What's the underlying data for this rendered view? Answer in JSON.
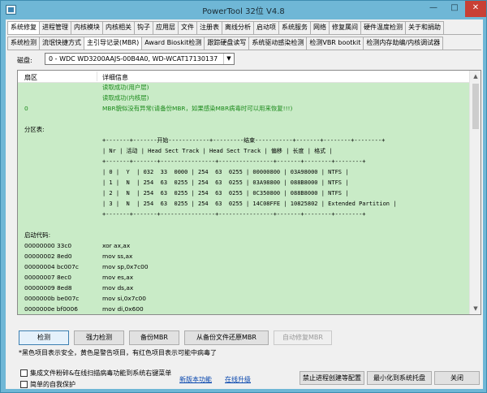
{
  "window": {
    "title": "PowerTool 32位 V4.8"
  },
  "tabs_main": [
    "系统修复",
    "进程管理",
    "内核模块",
    "内核相关",
    "钩子",
    "应用层",
    "文件",
    "注册表",
    "离线分析",
    "启动项",
    "系统服务",
    "网络",
    "修复属间",
    "硬件温度检测",
    "关于和捐助"
  ],
  "tabs_sub": [
    "系统检测",
    "流氓快捷方式",
    "主引导记录(MBR)",
    "Award Bioskit检测",
    "跟踪硬盘读写",
    "系统驱动感染检测",
    "检测VBR bootkit",
    "检测内存劫编/内核调试器"
  ],
  "disk": {
    "label": "磁盘:",
    "selected": "0 - WDC WD3200AAJS-00B4A0, WD-WCAT17130137"
  },
  "list": {
    "headers": [
      "扇区",
      "详细信息"
    ],
    "rows": [
      {
        "c1": "",
        "c2": "读取成功(用户层)",
        "green": true
      },
      {
        "c1": "",
        "c2": "读取成功(内核层)",
        "green": true
      },
      {
        "c1": "0",
        "c2": "MBR貌似没有异常(请备份MBR，如果感染MBR病毒时可以用来恢复!!!)",
        "green": true
      },
      {
        "c1": "",
        "c2": ""
      },
      {
        "c1": "分区表:",
        "c2": ""
      },
      {
        "c1": "",
        "c2": "+-------+-------开始------------+---------结束-----------+-------+--------+--------+",
        "mono": true
      },
      {
        "c1": "",
        "c2": "| Nr | 活动 | Head Sect Track | Head Sect Track | 偏移 | 长度 | 格式 |",
        "mono": true
      },
      {
        "c1": "",
        "c2": "+-------+-------+----------------+----------------+-------+--------+--------+",
        "mono": true
      },
      {
        "c1": "",
        "c2": "| 0 |  Y  | 032  33  0000 | 254  63  0255 | 00000800 | 03A98000 | NTFS |",
        "mono": true
      },
      {
        "c1": "",
        "c2": "| 1 |  N  | 254  63  0255 | 254  63  0255 | 03A98800 | 088B8000 | NTFS |",
        "mono": true
      },
      {
        "c1": "",
        "c2": "| 2 |  N  | 254  63  0255 | 254  63  0255 | 0C350800 | 088B8000 | NTFS |",
        "mono": true
      },
      {
        "c1": "",
        "c2": "| 3 |  N  | 254  63  0255 | 254  63  0255 | 14C08FFE | 10825802 | Extended Partition |",
        "mono": true
      },
      {
        "c1": "",
        "c2": "+-------+-------+----------------+----------------+-------+--------+--------+",
        "mono": true
      },
      {
        "c1": "",
        "c2": ""
      },
      {
        "c1": "启动代码:",
        "c2": ""
      },
      {
        "c1": "00000000 33c0",
        "c2": "xor ax,ax"
      },
      {
        "c1": "00000002 8ed0",
        "c2": "mov ss,ax"
      },
      {
        "c1": "00000004 bc007c",
        "c2": "mov sp,0x7c00"
      },
      {
        "c1": "00000007 8ec0",
        "c2": "mov es,ax"
      },
      {
        "c1": "00000009 8ed8",
        "c2": "mov ds,ax"
      },
      {
        "c1": "0000000b be007c",
        "c2": "mov si,0x7c00"
      },
      {
        "c1": "0000000e bf0006",
        "c2": "mov di,0x600"
      }
    ]
  },
  "buttons": [
    "检测",
    "强力检测",
    "备份MBR",
    "从备份文件还原MBR",
    "自动修复MBR"
  ],
  "note": "*黑色项目表示安全，黄色是警告项目，有红色项目表示可能中病毒了",
  "checkboxes": [
    "集成文件粉碎&在线扫描病毒功能到系统右键菜单",
    "简单的自我保护"
  ],
  "links": [
    "新版本功能",
    "在线升级"
  ],
  "bottom_buttons": [
    "禁止进程创建等配置",
    "最小化到系统托盘",
    "关闭"
  ]
}
